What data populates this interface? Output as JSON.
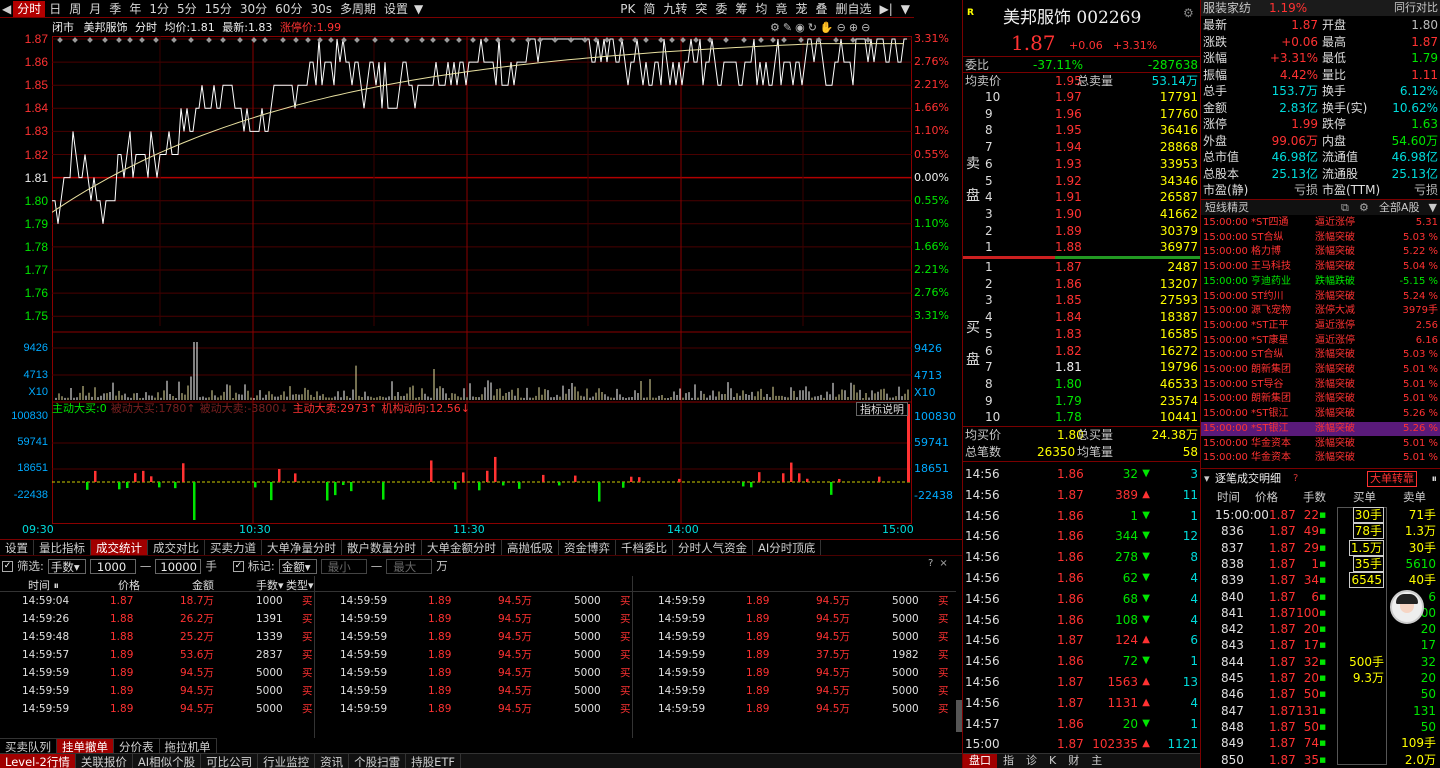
{
  "toolbar": {
    "items": [
      "分时",
      "日",
      "周",
      "月",
      "季",
      "年",
      "1分",
      "5分",
      "15分",
      "30分",
      "60分",
      "30s",
      "多周期",
      "设置"
    ],
    "right_items": [
      "PK",
      "简",
      "九转",
      "突",
      "委",
      "筹",
      "均",
      "竟",
      "茏",
      "叠",
      "删自选"
    ]
  },
  "chart": {
    "info": {
      "market": "闭市",
      "name": "美邦服饰",
      "mode": "分时",
      "avg_label": "均价:",
      "avg": "1.81",
      "latest_label": "最新:",
      "latest": "1.83",
      "limit_label": "涨停价:",
      "limit": "1.99"
    },
    "left_prices": [
      "1.87",
      "1.86",
      "1.85",
      "1.84",
      "1.83",
      "1.82",
      "1.81",
      "1.80",
      "1.79",
      "1.78",
      "1.77",
      "1.76",
      "1.75"
    ],
    "right_pcts": [
      "3.31%",
      "2.76%",
      "2.21%",
      "1.66%",
      "1.10%",
      "0.55%",
      "0.00%",
      "0.55%",
      "1.10%",
      "1.66%",
      "2.21%",
      "2.76%",
      "3.31%"
    ],
    "vol_left": [
      "9426",
      "4713",
      "X10"
    ],
    "vol_right": [
      "9426",
      "4713",
      "X10"
    ],
    "flow_header": [
      {
        "label": "主动大买:",
        "value": "0",
        "color": "green"
      },
      {
        "label": "被动大买:",
        "value": "1780↑",
        "color": "dim"
      },
      {
        "label": "被动大卖:",
        "value": "-3800↓",
        "color": "dim"
      },
      {
        "label": "主动大卖:",
        "value": "2973↑",
        "color": "red"
      },
      {
        "label": "机构动向:",
        "value": "12.56↓",
        "color": "red"
      }
    ],
    "flow_btn": "指标说明",
    "flow_axis": [
      "100830",
      "59741",
      "18651",
      "-22438"
    ],
    "times": [
      "09:30",
      "10:30",
      "11:30",
      "14:00",
      "15:00"
    ],
    "chart_data": {
      "type": "line",
      "x_ticks": [
        "09:30",
        "10:30",
        "11:30",
        "14:00",
        "15:00"
      ],
      "y_range": [
        1.75,
        1.87
      ],
      "prev_close": 1.81,
      "series": []
    }
  },
  "bottom_tabs": [
    "设置",
    "量比指标",
    "成交统计",
    "成交对比",
    "买卖力道",
    "大单净量分时",
    "散户数量分时",
    "大单金额分时",
    "高抛低吸",
    "资金博弈",
    "千档委比",
    "分时人气资金",
    "AI分时顶底"
  ],
  "filter": {
    "filter_label": "筛选:",
    "unit": "手数",
    "min": "1000",
    "max": "10000",
    "hand": "手",
    "mark_label": "标记:",
    "mark_unit": "金额",
    "min_ph": "最小",
    "max_ph": "最大",
    "wan": "万"
  },
  "trades_header": [
    "时间",
    "价格",
    "金额",
    "手数",
    "类型"
  ],
  "trades_col1": [
    [
      "14:59:04",
      "1.87",
      "18.7万",
      "1000",
      "买"
    ],
    [
      "14:59:26",
      "1.88",
      "26.2万",
      "1391",
      "买"
    ],
    [
      "14:59:48",
      "1.88",
      "25.2万",
      "1339",
      "买"
    ],
    [
      "14:59:57",
      "1.89",
      "53.6万",
      "2837",
      "买"
    ],
    [
      "14:59:59",
      "1.89",
      "94.5万",
      "5000",
      "买"
    ],
    [
      "14:59:59",
      "1.89",
      "94.5万",
      "5000",
      "买"
    ],
    [
      "14:59:59",
      "1.89",
      "94.5万",
      "5000",
      "买"
    ]
  ],
  "trades_col2": [
    [
      "14:59:59",
      "1.89",
      "94.5万",
      "5000",
      "买"
    ],
    [
      "14:59:59",
      "1.89",
      "94.5万",
      "5000",
      "买"
    ],
    [
      "14:59:59",
      "1.89",
      "94.5万",
      "5000",
      "买"
    ],
    [
      "14:59:59",
      "1.89",
      "94.5万",
      "5000",
      "买"
    ],
    [
      "14:59:59",
      "1.89",
      "94.5万",
      "5000",
      "买"
    ],
    [
      "14:59:59",
      "1.89",
      "94.5万",
      "5000",
      "买"
    ],
    [
      "14:59:59",
      "1.89",
      "94.5万",
      "5000",
      "买"
    ]
  ],
  "trades_col3": [
    [
      "14:59:59",
      "1.89",
      "94.5万",
      "5000",
      "买"
    ],
    [
      "14:59:59",
      "1.89",
      "94.5万",
      "5000",
      "买"
    ],
    [
      "14:59:59",
      "1.89",
      "94.5万",
      "5000",
      "买"
    ],
    [
      "14:59:59",
      "1.89",
      "37.5万",
      "1982",
      "买"
    ],
    [
      "14:59:59",
      "1.89",
      "94.5万",
      "5000",
      "买"
    ],
    [
      "14:59:59",
      "1.89",
      "94.5万",
      "5000",
      "买"
    ],
    [
      "14:59:59",
      "1.89",
      "94.5万",
      "5000",
      "买"
    ]
  ],
  "tabs_lower": [
    "买卖队列",
    "挂单撤单",
    "分价表",
    "拖拉机单"
  ],
  "status_tabs": [
    "Level-2行情",
    "关联报价",
    "AI相似个股",
    "可比公司",
    "行业监控",
    "资讯",
    "个股扫雷",
    "持股ETF"
  ],
  "quote": {
    "r_badge": "R",
    "title": "美邦服饰 002269",
    "price": "1.87",
    "change": "+0.06",
    "pct": "+3.31%",
    "webi_label": "委比",
    "webi": "-37.11%",
    "wecha": "-287638",
    "ask_avg_label": "均卖价",
    "ask_avg": "1.95",
    "ask_total_label": "总卖量",
    "ask_total": "53.14万",
    "sell_label": "卖盘",
    "asks": [
      [
        "10",
        "1.97",
        "17791"
      ],
      [
        "9",
        "1.96",
        "17760"
      ],
      [
        "8",
        "1.95",
        "36416"
      ],
      [
        "7",
        "1.94",
        "28868"
      ],
      [
        "6",
        "1.93",
        "33953"
      ],
      [
        "5",
        "1.92",
        "34346"
      ],
      [
        "4",
        "1.91",
        "26587"
      ],
      [
        "3",
        "1.90",
        "41662"
      ],
      [
        "2",
        "1.89",
        "30379"
      ],
      [
        "1",
        "1.88",
        "36977"
      ]
    ],
    "buy_label": "买盘",
    "bids": [
      [
        "1",
        "1.87",
        "2487"
      ],
      [
        "2",
        "1.86",
        "13207"
      ],
      [
        "3",
        "1.85",
        "27593"
      ],
      [
        "4",
        "1.84",
        "18387"
      ],
      [
        "5",
        "1.83",
        "16585"
      ],
      [
        "6",
        "1.82",
        "16272"
      ],
      [
        "7",
        "1.81",
        "19796"
      ],
      [
        "8",
        "1.80",
        "46533"
      ],
      [
        "9",
        "1.79",
        "23574"
      ],
      [
        "10",
        "1.78",
        "10441"
      ]
    ],
    "bid_avg_label": "均买价",
    "bid_avg": "1.80",
    "bid_total_label": "总买量",
    "bid_total": "24.38万",
    "count_label": "总笔数",
    "count": "26350",
    "avgvol_label": "均笔量",
    "avgvol": "58"
  },
  "ticks": [
    [
      "14:56",
      "1.86",
      "32",
      "down",
      "3"
    ],
    [
      "14:56",
      "1.87",
      "389",
      "up",
      "11"
    ],
    [
      "14:56",
      "1.86",
      "1",
      "down",
      "1"
    ],
    [
      "14:56",
      "1.86",
      "344",
      "down",
      "12"
    ],
    [
      "14:56",
      "1.86",
      "278",
      "down",
      "8"
    ],
    [
      "14:56",
      "1.86",
      "62",
      "down",
      "4"
    ],
    [
      "14:56",
      "1.86",
      "68",
      "down",
      "4"
    ],
    [
      "14:56",
      "1.86",
      "108",
      "down",
      "4"
    ],
    [
      "14:56",
      "1.87",
      "124",
      "up",
      "6"
    ],
    [
      "14:56",
      "1.86",
      "72",
      "down",
      "1"
    ],
    [
      "14:56",
      "1.87",
      "1563",
      "up",
      "13"
    ],
    [
      "14:56",
      "1.87",
      "1131",
      "up",
      "4"
    ],
    [
      "14:57",
      "1.86",
      "20",
      "down",
      "1"
    ],
    [
      "15:00",
      "1.87",
      "102335",
      "up",
      "1121"
    ]
  ],
  "bottom_icons": [
    "盘口",
    "指",
    "诊",
    "K",
    "财",
    "主"
  ],
  "stats": {
    "sector": "服装家纺",
    "sector_pct": "1.19%",
    "sector_btn": "同行对比",
    "rows": [
      [
        [
          "最新",
          "1.87",
          "red"
        ],
        [
          "开盘",
          "1.80",
          "gray"
        ]
      ],
      [
        [
          "涨跌",
          "+0.06",
          "red"
        ],
        [
          "最高",
          "1.87",
          "red"
        ]
      ],
      [
        [
          "涨幅",
          "+3.31%",
          "red"
        ],
        [
          "最低",
          "1.79",
          "green"
        ]
      ],
      [
        [
          "振幅",
          "4.42%",
          "red"
        ],
        [
          "量比",
          "1.11",
          "red"
        ]
      ],
      [
        [
          "总手",
          "153.7万",
          "cyan"
        ],
        [
          "换手",
          "6.12%",
          "cyan"
        ]
      ],
      [
        [
          "金额",
          "2.83亿",
          "cyan"
        ],
        [
          "换手(实)",
          "10.62%",
          "cyan"
        ]
      ],
      [
        [
          "涨停",
          "1.99",
          "red"
        ],
        [
          "跌停",
          "1.63",
          "green"
        ]
      ],
      [
        [
          "外盘",
          "99.06万",
          "red"
        ],
        [
          "内盘",
          "54.60万",
          "green"
        ]
      ],
      [
        [
          "总市值",
          "46.98亿",
          "cyan"
        ],
        [
          "流通值",
          "46.98亿",
          "cyan"
        ]
      ],
      [
        [
          "总股本",
          "25.13亿",
          "cyan"
        ],
        [
          "流通股",
          "25.13亿",
          "cyan"
        ]
      ],
      [
        [
          "市盈(静)",
          "亏损",
          "gray"
        ],
        [
          "市盈(TTM)",
          "亏损",
          "gray"
        ]
      ]
    ]
  },
  "sprites": {
    "title": "短线精灵",
    "filter": "全部A股",
    "rows": [
      [
        "15:00:00",
        "*ST四通",
        "逼近涨停",
        "5.31"
      ],
      [
        "15:00:00",
        "ST合纵",
        "涨幅突破",
        "5.03 %"
      ],
      [
        "15:00:00",
        "格力博",
        "涨幅突破",
        "5.22 %"
      ],
      [
        "15:00:00",
        "王马科技",
        "涨幅突破",
        "5.04 %"
      ],
      [
        "15:00:00",
        "亨迪药业",
        "跌幅跌破",
        "-5.15 %"
      ],
      [
        "15:00:00",
        "ST约川",
        "涨幅突破",
        "5.24 %"
      ],
      [
        "15:00:00",
        "源飞宠物",
        "涨停大减",
        "3979手"
      ],
      [
        "15:00:00",
        "*ST正平",
        "逼近涨停",
        "2.56"
      ],
      [
        "15:00:00",
        "*ST康星",
        "逼近涨停",
        "6.16"
      ],
      [
        "15:00:00",
        "ST合纵",
        "涨幅突破",
        "5.03 %"
      ],
      [
        "15:00:00",
        "朗新集团",
        "涨幅突破",
        "5.01 %"
      ],
      [
        "15:00:00",
        "ST导谷",
        "涨幅突破",
        "5.01 %"
      ],
      [
        "15:00:00",
        "朗新集团",
        "涨幅突破",
        "5.01 %"
      ],
      [
        "15:00:00",
        "*ST银江",
        "涨幅突破",
        "5.26 %"
      ],
      [
        "15:00:00",
        "*ST银江",
        "涨幅突破",
        "5.26 %"
      ],
      [
        "15:00:00",
        "华金资本",
        "涨幅突破",
        "5.01 %"
      ],
      [
        "15:00:00",
        "华金资本",
        "涨幅突破",
        "5.01 %"
      ]
    ]
  },
  "detail": {
    "title": "逐笔成交明细",
    "btn": "大单转靠",
    "headers": [
      "时间",
      "价格",
      "手数",
      "买单",
      "卖单"
    ],
    "rows": [
      [
        "15:00:00",
        "1.87",
        "22",
        "30手",
        "71手"
      ],
      [
        "836",
        "1.87",
        "49",
        "78手",
        "1.3万"
      ],
      [
        "837",
        "1.87",
        "29",
        "1.5万",
        "30手"
      ],
      [
        "838",
        "1.87",
        "1",
        "35手",
        "5610"
      ],
      [
        "839",
        "1.87",
        "34",
        "6545",
        "40手"
      ],
      [
        "840",
        "1.87",
        "6",
        "",
        "6"
      ],
      [
        "841",
        "1.87",
        "100",
        "",
        "100"
      ],
      [
        "842",
        "1.87",
        "20",
        "",
        "20"
      ],
      [
        "843",
        "1.87",
        "17",
        "",
        "17"
      ],
      [
        "844",
        "1.87",
        "32",
        "500手",
        "32"
      ],
      [
        "845",
        "1.87",
        "20",
        "9.3万",
        "20"
      ],
      [
        "846",
        "1.87",
        "50",
        "",
        "50"
      ],
      [
        "847",
        "1.87",
        "131",
        "",
        "131"
      ],
      [
        "848",
        "1.87",
        "50",
        "",
        "50"
      ],
      [
        "849",
        "1.87",
        "74",
        "",
        "109手"
      ],
      [
        "850",
        "1.87",
        "35",
        "",
        "2.0万"
      ]
    ]
  },
  "colors": {
    "accent": "#b30000",
    "up": "#ff3232",
    "down": "#00e600",
    "avgline": "#e8e0a0",
    "priceline": "#ffffff"
  }
}
